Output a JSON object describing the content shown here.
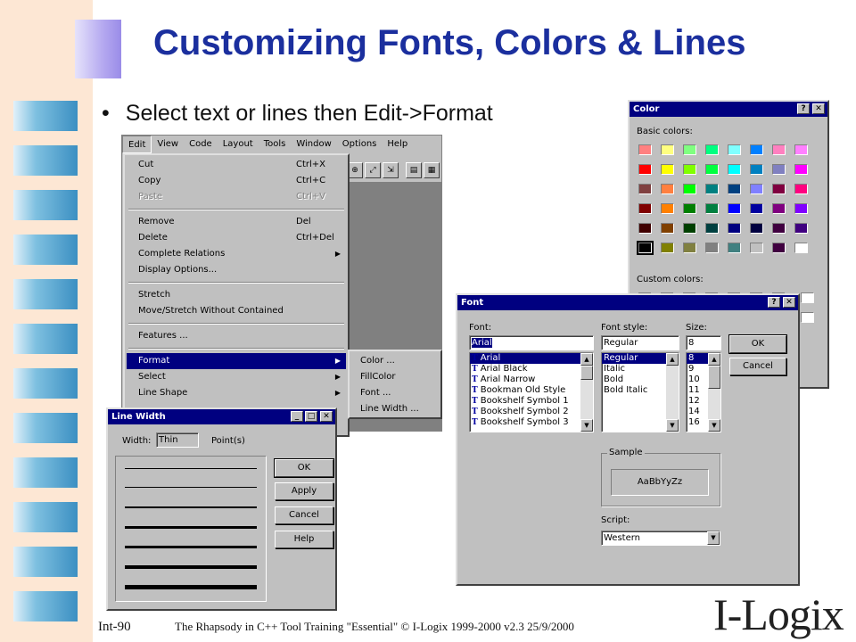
{
  "slide": {
    "title": "Customizing Fonts, Colors & Lines",
    "bullet": "Select text or lines then Edit->Format",
    "page_number": "Int-90",
    "footer": "The Rhapsody in C++ Tool Training \"Essential\"   © I-Logix 1999-2000   v2.3  25/9/2000",
    "logo": "I-Logix"
  },
  "menubar": [
    "Edit",
    "View",
    "Code",
    "Layout",
    "Tools",
    "Window",
    "Options",
    "Help"
  ],
  "edit_menu": {
    "items": [
      {
        "label": "Cut",
        "shortcut": "Ctrl+X"
      },
      {
        "label": "Copy",
        "shortcut": "Ctrl+C"
      },
      {
        "label": "Paste",
        "shortcut": "Ctrl+V"
      },
      {
        "label": "Remove",
        "shortcut": "Del"
      },
      {
        "label": "Delete",
        "shortcut": "Ctrl+Del"
      },
      {
        "label": "Complete Relations",
        "shortcut": ""
      },
      {
        "label": "Display Options...",
        "shortcut": ""
      },
      {
        "label": "Stretch",
        "shortcut": ""
      },
      {
        "label": "Move/Stretch Without Contained",
        "shortcut": ""
      },
      {
        "label": "Features ...",
        "shortcut": ""
      },
      {
        "label": "Format",
        "shortcut": ""
      },
      {
        "label": "Select",
        "shortcut": ""
      },
      {
        "label": "Line Shape",
        "shortcut": ""
      }
    ]
  },
  "format_submenu": [
    "Color ...",
    "FillColor",
    "Font ...",
    "Line Width ..."
  ],
  "color_dialog": {
    "title": "Color",
    "basic_label": "Basic colors:",
    "custom_label": "Custom colors:",
    "help_btn": "?",
    "close_btn": "✕",
    "swatches": [
      "#ff8080",
      "#ffff80",
      "#80ff80",
      "#00ff80",
      "#80ffff",
      "#0080ff",
      "#ff80c0",
      "#ff80ff",
      "#ff0000",
      "#ffff00",
      "#80ff00",
      "#00ff40",
      "#00ffff",
      "#0080c0",
      "#8080c0",
      "#ff00ff",
      "#804040",
      "#ff8040",
      "#00ff00",
      "#008080",
      "#004080",
      "#8080ff",
      "#800040",
      "#ff0080",
      "#800000",
      "#ff8000",
      "#008000",
      "#008040",
      "#0000ff",
      "#0000a0",
      "#800080",
      "#8000ff",
      "#400000",
      "#804000",
      "#004000",
      "#004040",
      "#000080",
      "#000040",
      "#400040",
      "#400080",
      "#000000",
      "#808000",
      "#808040",
      "#808080",
      "#408080",
      "#c0c0c0",
      "#400040",
      "#ffffff"
    ]
  },
  "font_dialog": {
    "title": "Font",
    "font_label": "Font:",
    "style_label": "Font style:",
    "size_label": "Size:",
    "font_value": "Arial",
    "style_value": "Regular",
    "size_value": "8",
    "fonts": [
      "Arial",
      "Arial Black",
      "Arial Narrow",
      "Bookman Old Style",
      "Bookshelf Symbol 1",
      "Bookshelf Symbol 2",
      "Bookshelf Symbol 3"
    ],
    "styles": [
      "Regular",
      "Italic",
      "Bold",
      "Bold Italic"
    ],
    "sizes": [
      "8",
      "9",
      "10",
      "11",
      "12",
      "14",
      "16"
    ],
    "ok": "OK",
    "cancel": "Cancel",
    "sample_label": "Sample",
    "sample_text": "AaBbYyZz",
    "script_label": "Script:",
    "script_value": "Western"
  },
  "line_width_dialog": {
    "title": "Line Width",
    "width_label": "Width:",
    "width_value": "Thin",
    "unit_label": "Point(s)",
    "ok": "OK",
    "apply": "Apply",
    "cancel": "Cancel",
    "help": "Help"
  }
}
